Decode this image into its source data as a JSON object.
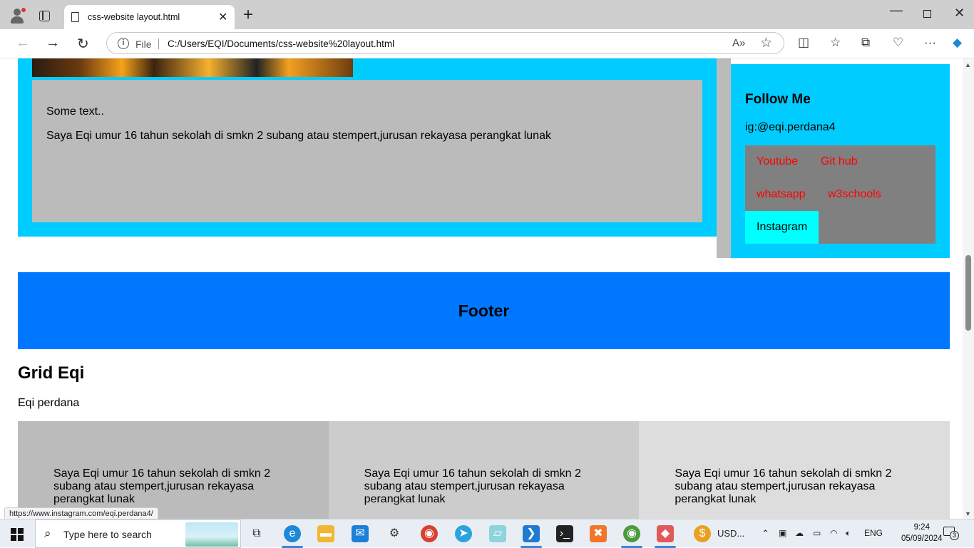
{
  "browser": {
    "tab_title": "css-website layout.html",
    "address_label": "File",
    "url": "C:/Users/EQI/Documents/css-website%20layout.html"
  },
  "content": {
    "intro_text": "Some text..",
    "bio_text": "Saya Eqi umur 16 tahun sekolah di smkn 2 subang atau stempert,jurusan rekayasa perangkat lunak",
    "follow_title": "Follow Me",
    "instagram_handle": "ig:@eqi.perdana4",
    "links": [
      "Youtube",
      "Git hub",
      "whatsapp",
      "w3schools",
      "Instagram"
    ],
    "footer_title": "Footer",
    "grid_title": "Grid Eqi",
    "grid_subtitle": "Eqi perdana",
    "grid_cells": [
      "Saya Eqi umur 16 tahun sekolah di smkn 2 subang atau stempert,jurusan rekayasa perangkat lunak",
      "Saya Eqi umur 16 tahun sekolah di smkn 2 subang atau stempert,jurusan rekayasa perangkat lunak",
      "Saya Eqi umur 16 tahun sekolah di smkn 2 subang atau stempert,jurusan rekayasa perangkat lunak"
    ]
  },
  "status_url": "https://www.instagram.com/eqi.perdana4/",
  "taskbar": {
    "search_placeholder": "Type here to search",
    "currency_widget": "USD...",
    "language": "ENG",
    "time": "9:24",
    "date": "05/09/2024",
    "notification_count": "3"
  },
  "colors": {
    "cyan_panel": "#00ccff",
    "footer_blue": "#0077ff",
    "link_red": "#ff0000",
    "insta_active": "#00ffff"
  }
}
